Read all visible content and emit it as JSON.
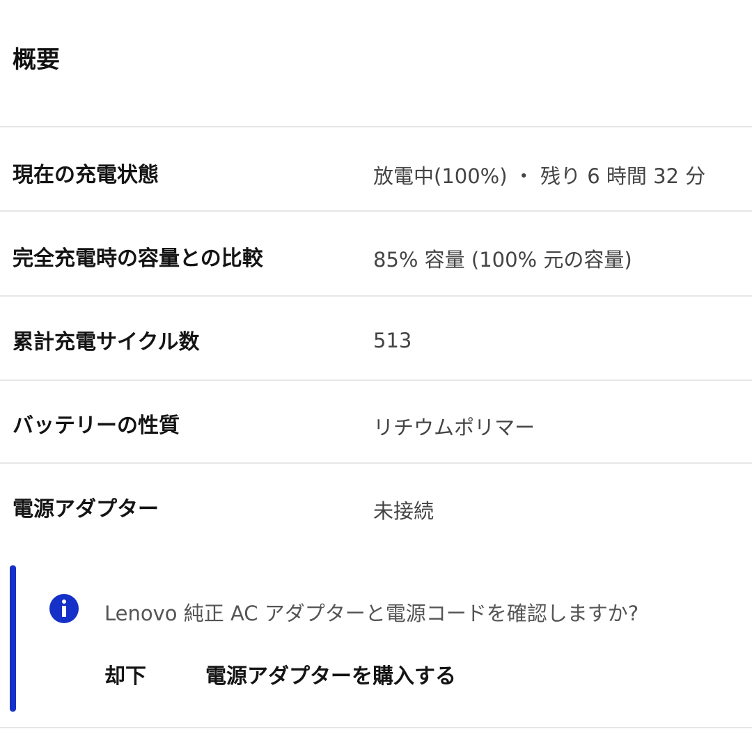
{
  "section": {
    "title": "概要"
  },
  "rows": [
    {
      "label": "現在の充電状態",
      "value": "放電中(100%) ・ 残り 6 時間 32 分"
    },
    {
      "label": "完全充電時の容量との比較",
      "value": "85% 容量 (100% 元の容量)"
    },
    {
      "label": "累計充電サイクル数",
      "value": "513"
    },
    {
      "label": "バッテリーの性質",
      "value": "リチウムポリマー"
    },
    {
      "label": "電源アダプター",
      "value": "未接続"
    }
  ],
  "notice": {
    "icon": "info-icon",
    "message": "Lenovo 純正 AC アダプターと電源コードを確認しますか?",
    "dismiss_label": "却下",
    "buy_label": "電源アダプターを購入する"
  },
  "colors": {
    "accent": "#1531c8",
    "divider": "#e6e6e6",
    "value_text": "#444444"
  }
}
